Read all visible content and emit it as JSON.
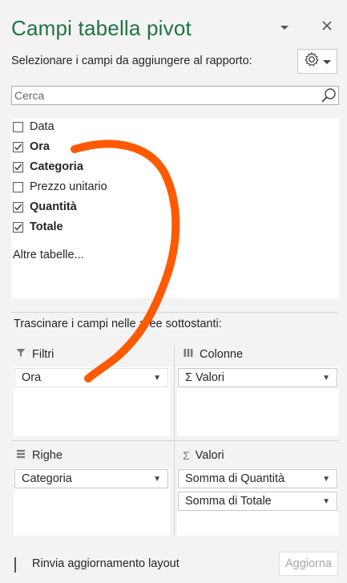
{
  "panel": {
    "title": "Campi tabella pivot",
    "subtitle": "Selezionare i campi da aggiungere al rapporto:"
  },
  "search": {
    "placeholder": "Cerca",
    "value": ""
  },
  "fields": [
    {
      "label": "Data",
      "checked": false
    },
    {
      "label": "Ora",
      "checked": true
    },
    {
      "label": "Categoria",
      "checked": true
    },
    {
      "label": "Prezzo unitario",
      "checked": false
    },
    {
      "label": "Quantità",
      "checked": true
    },
    {
      "label": "Totale",
      "checked": true
    }
  ],
  "more_tables": "Altre tabelle...",
  "drag_label": "Trascinare i campi nelle aree sottostanti:",
  "areas": {
    "filters": {
      "label": "Filtri",
      "items": [
        "Ora"
      ]
    },
    "columns": {
      "label": "Colonne",
      "items": [
        "Σ Valori"
      ]
    },
    "rows": {
      "label": "Righe",
      "items": [
        "Categoria"
      ]
    },
    "values": {
      "label": "Valori",
      "items": [
        "Somma di Quantità",
        "Somma di Totale"
      ]
    }
  },
  "footer": {
    "defer_label": "Rinvia aggiornamento layout",
    "defer_checked": false,
    "update_label": "Aggiorna"
  },
  "colors": {
    "title": "#217346",
    "annotation_stroke": "#ff5a00"
  }
}
